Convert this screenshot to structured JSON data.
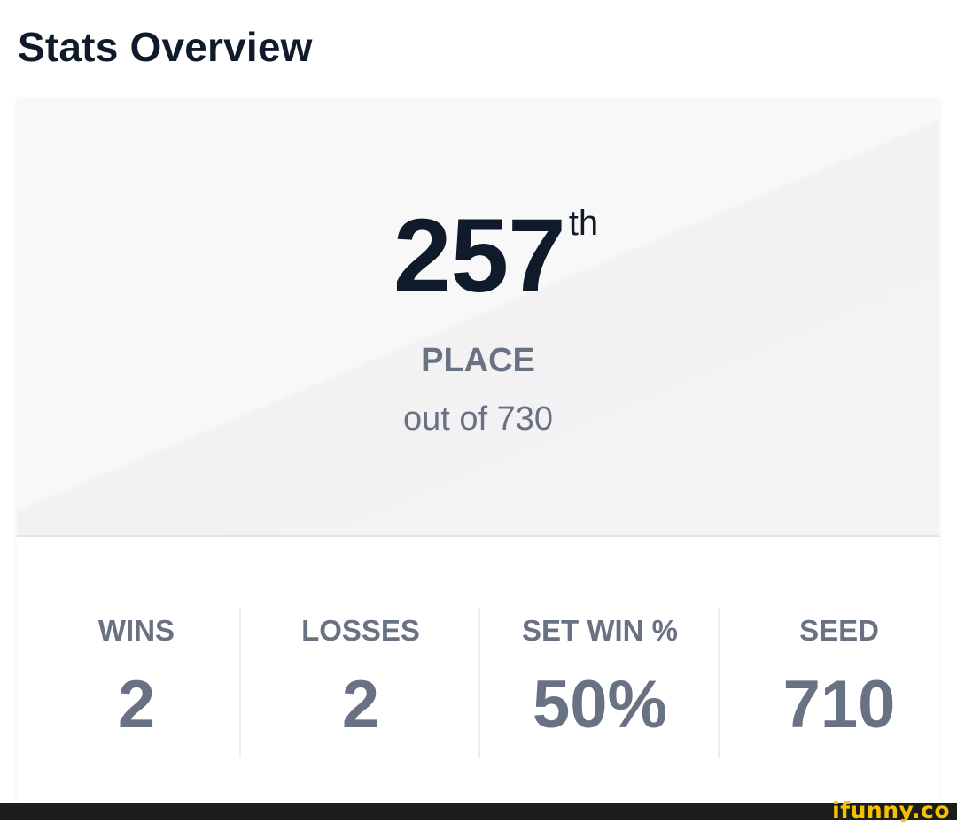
{
  "header": {
    "title": "Stats Overview"
  },
  "placement": {
    "rank": "257",
    "suffix": "th",
    "label": "PLACE",
    "total_text": "out of 730"
  },
  "stats": [
    {
      "label": "WINS",
      "value": "2"
    },
    {
      "label": "LOSSES",
      "value": "2"
    },
    {
      "label": "SET WIN %",
      "value": "50%"
    },
    {
      "label": "SEED",
      "value": "710"
    }
  ],
  "watermark": {
    "text": "ifunny.co"
  },
  "colors": {
    "title": "#0f1b2b",
    "muted_text": "#687282",
    "hero_background": "#f8f8f9",
    "divider": "#e2e3e6",
    "watermark": "#f5c200",
    "watermark_bar": "#1c1c1c"
  }
}
